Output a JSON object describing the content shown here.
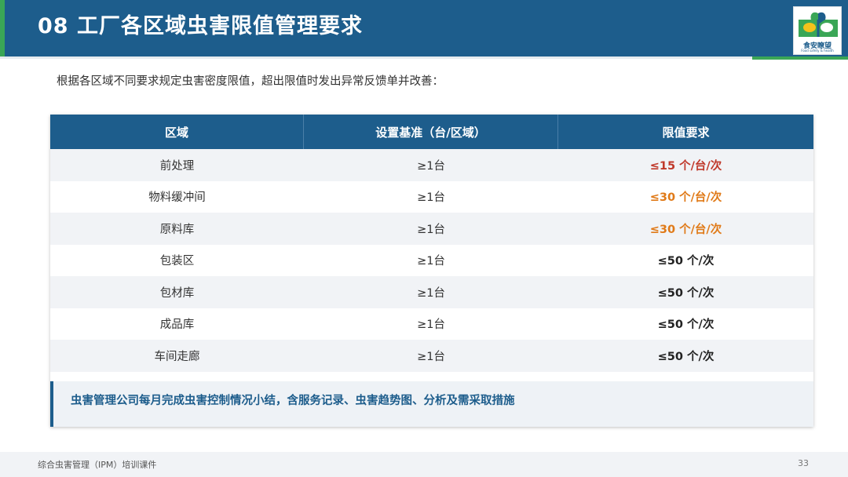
{
  "header": {
    "title": "08  工厂各区域虫害限值管理要求"
  },
  "logo": {
    "name": "食安瞭望",
    "subtitle": "Food safety & health"
  },
  "intro": "根据各区域不同要求规定虫害密度限值，超出限值时发出异常反馈单并改善：",
  "table": {
    "headers": [
      "区域",
      "设置基准（台/区域）",
      "限值要求"
    ],
    "rows": [
      {
        "area": "前处理",
        "standard": "≥1台",
        "limit": "≤15 个/台/次",
        "level": "red"
      },
      {
        "area": "物料缓冲间",
        "standard": "≥1台",
        "limit": "≤30 个/台/次",
        "level": "orange"
      },
      {
        "area": "原料库",
        "standard": "≥1台",
        "limit": "≤30 个/台/次",
        "level": "orange"
      },
      {
        "area": "包装区",
        "standard": "≥1台",
        "limit": "≤50 个/次",
        "level": "dark"
      },
      {
        "area": "包材库",
        "standard": "≥1台",
        "limit": "≤50 个/次",
        "level": "dark"
      },
      {
        "area": "成品库",
        "standard": "≥1台",
        "limit": "≤50 个/次",
        "level": "dark"
      },
      {
        "area": "车间走廊",
        "standard": "≥1台",
        "limit": "≤50 个/次",
        "level": "dark"
      }
    ]
  },
  "callout": "虫害管理公司每月完成虫害控制情况小结，含服务记录、虫害趋势图、分析及需采取措施",
  "footer": {
    "course": "综合虫害管理（IPM）培训课件",
    "page": "33"
  },
  "colors": {
    "primary": "#1d5d8c",
    "accent_green": "#3aa656",
    "limit_red": "#c0392b",
    "limit_orange": "#e07a18"
  }
}
